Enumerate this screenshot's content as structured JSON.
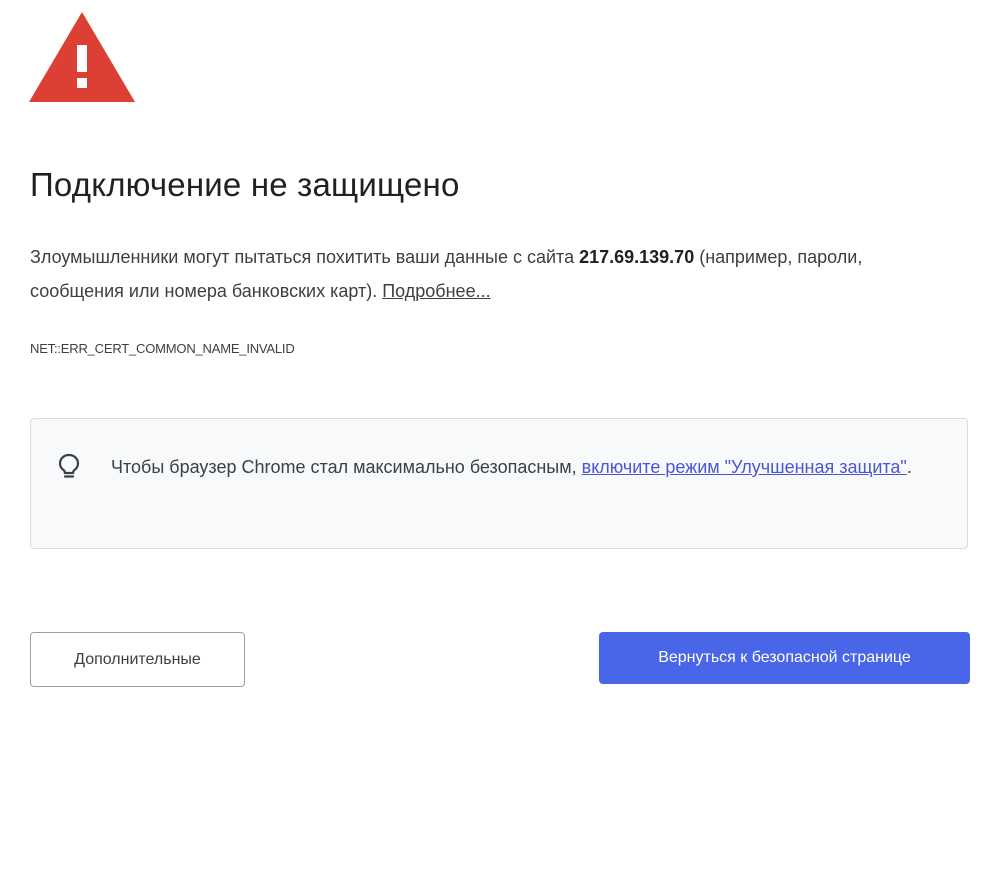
{
  "title": "Подключение не защищено",
  "description": {
    "prefix": "Злоумышленники могут пытаться похитить ваши данные с сайта ",
    "host": "217.69.139.70",
    "suffix": " (например, пароли, сообщения или номера банковских карт). ",
    "learn_more": "Подробнее..."
  },
  "error_code": "NET::ERR_CERT_COMMON_NAME_INVALID",
  "enhanced_protection": {
    "prefix": "Чтобы браузер Chrome стал максимально безопасным, ",
    "link": "включите режим \"Улучшенная защита\"",
    "suffix": "."
  },
  "buttons": {
    "advanced": "Дополнительные",
    "back_to_safety": "Вернуться к безопасной странице"
  },
  "colors": {
    "warning_red": "#dc4034",
    "primary_button": "#4a66e8",
    "link": "#4a55d8"
  },
  "icons": {
    "warning": "warning-triangle-icon",
    "tip": "lightbulb-icon"
  }
}
